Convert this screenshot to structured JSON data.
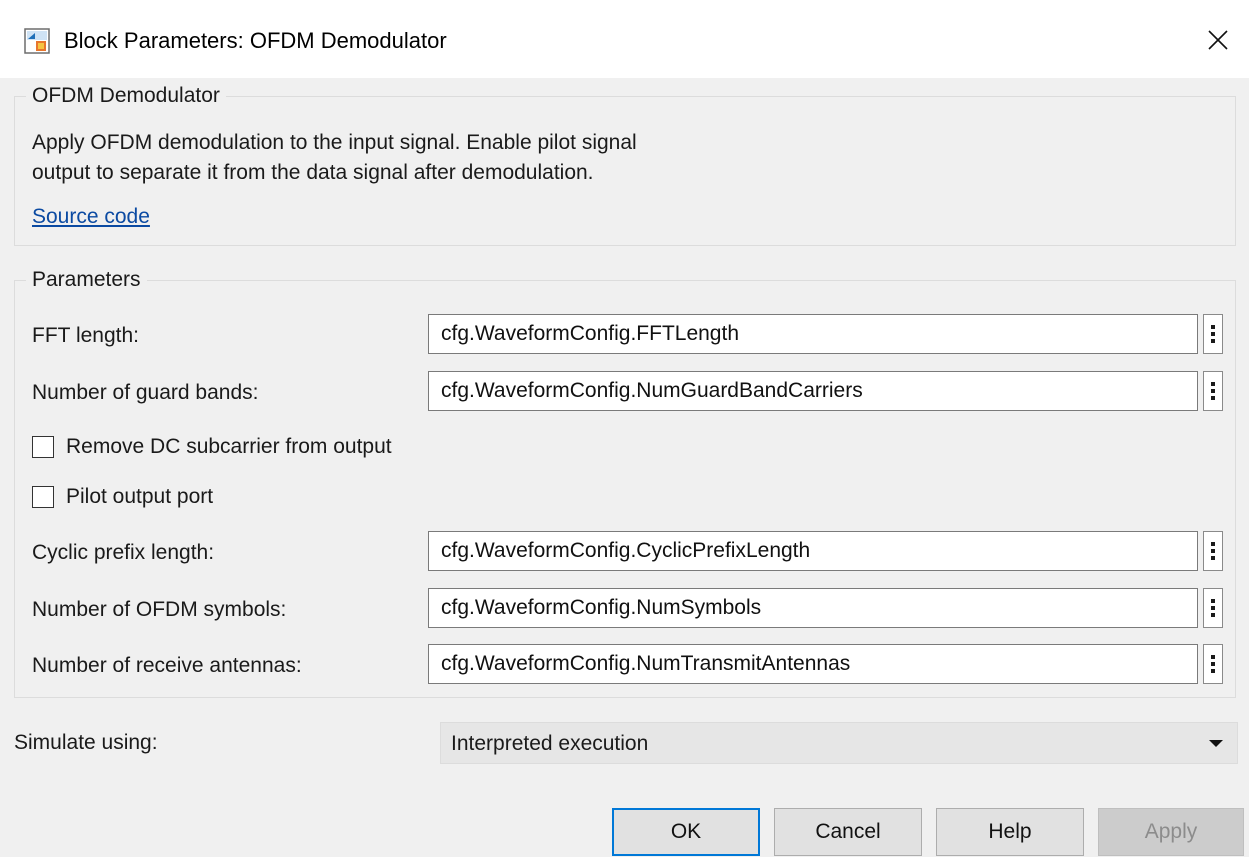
{
  "window": {
    "title": "Block Parameters: OFDM Demodulator",
    "icon": "simulink-block-icon",
    "close_icon": "close-icon"
  },
  "description_group": {
    "title": "OFDM Demodulator",
    "lines": [
      "Apply OFDM demodulation to the input signal. Enable pilot signal",
      "output to separate it from the data signal after demodulation."
    ],
    "link": "Source code"
  },
  "parameters": {
    "title": "Parameters",
    "fft_length": {
      "label": "FFT length:",
      "value": "cfg.WaveformConfig.FFTLength"
    },
    "guard_bands": {
      "label": "Number of guard bands:",
      "value": "cfg.WaveformConfig.NumGuardBandCarriers"
    },
    "remove_dc": {
      "label": "Remove DC subcarrier from output",
      "checked": false
    },
    "pilot_port": {
      "label": "Pilot output port",
      "checked": false
    },
    "cyclic_prefix": {
      "label": "Cyclic prefix length:",
      "value": "cfg.WaveformConfig.CyclicPrefixLength"
    },
    "num_symbols": {
      "label": "Number of OFDM symbols:",
      "value": "cfg.WaveformConfig.NumSymbols"
    },
    "receive_antennas": {
      "label": "Number of receive antennas:",
      "value": "cfg.WaveformConfig.NumTransmitAntennas"
    }
  },
  "simulate": {
    "label": "Simulate using:",
    "value": "Interpreted execution"
  },
  "buttons": {
    "ok": "OK",
    "cancel": "Cancel",
    "help": "Help",
    "apply": "Apply"
  },
  "colors": {
    "background": "#f0f0f0",
    "link": "#0b4aa2",
    "focus_border": "#0078d7"
  }
}
